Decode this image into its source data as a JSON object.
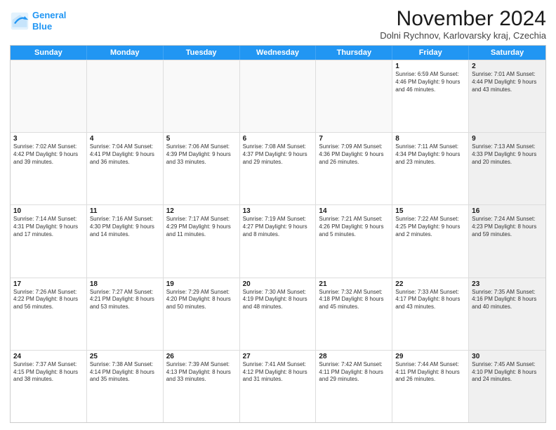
{
  "logo": {
    "line1": "General",
    "line2": "Blue"
  },
  "title": "November 2024",
  "location": "Dolni Rychnov, Karlovarsky kraj, Czechia",
  "header_days": [
    "Sunday",
    "Monday",
    "Tuesday",
    "Wednesday",
    "Thursday",
    "Friday",
    "Saturday"
  ],
  "rows": [
    [
      {
        "day": "",
        "info": "",
        "shaded": false,
        "empty": true
      },
      {
        "day": "",
        "info": "",
        "shaded": false,
        "empty": true
      },
      {
        "day": "",
        "info": "",
        "shaded": false,
        "empty": true
      },
      {
        "day": "",
        "info": "",
        "shaded": false,
        "empty": true
      },
      {
        "day": "",
        "info": "",
        "shaded": false,
        "empty": true
      },
      {
        "day": "1",
        "info": "Sunrise: 6:59 AM\nSunset: 4:46 PM\nDaylight: 9 hours\nand 46 minutes.",
        "shaded": false
      },
      {
        "day": "2",
        "info": "Sunrise: 7:01 AM\nSunset: 4:44 PM\nDaylight: 9 hours\nand 43 minutes.",
        "shaded": true
      }
    ],
    [
      {
        "day": "3",
        "info": "Sunrise: 7:02 AM\nSunset: 4:42 PM\nDaylight: 9 hours\nand 39 minutes.",
        "shaded": false
      },
      {
        "day": "4",
        "info": "Sunrise: 7:04 AM\nSunset: 4:41 PM\nDaylight: 9 hours\nand 36 minutes.",
        "shaded": false
      },
      {
        "day": "5",
        "info": "Sunrise: 7:06 AM\nSunset: 4:39 PM\nDaylight: 9 hours\nand 33 minutes.",
        "shaded": false
      },
      {
        "day": "6",
        "info": "Sunrise: 7:08 AM\nSunset: 4:37 PM\nDaylight: 9 hours\nand 29 minutes.",
        "shaded": false
      },
      {
        "day": "7",
        "info": "Sunrise: 7:09 AM\nSunset: 4:36 PM\nDaylight: 9 hours\nand 26 minutes.",
        "shaded": false
      },
      {
        "day": "8",
        "info": "Sunrise: 7:11 AM\nSunset: 4:34 PM\nDaylight: 9 hours\nand 23 minutes.",
        "shaded": false
      },
      {
        "day": "9",
        "info": "Sunrise: 7:13 AM\nSunset: 4:33 PM\nDaylight: 9 hours\nand 20 minutes.",
        "shaded": true
      }
    ],
    [
      {
        "day": "10",
        "info": "Sunrise: 7:14 AM\nSunset: 4:31 PM\nDaylight: 9 hours\nand 17 minutes.",
        "shaded": false
      },
      {
        "day": "11",
        "info": "Sunrise: 7:16 AM\nSunset: 4:30 PM\nDaylight: 9 hours\nand 14 minutes.",
        "shaded": false
      },
      {
        "day": "12",
        "info": "Sunrise: 7:17 AM\nSunset: 4:29 PM\nDaylight: 9 hours\nand 11 minutes.",
        "shaded": false
      },
      {
        "day": "13",
        "info": "Sunrise: 7:19 AM\nSunset: 4:27 PM\nDaylight: 9 hours\nand 8 minutes.",
        "shaded": false
      },
      {
        "day": "14",
        "info": "Sunrise: 7:21 AM\nSunset: 4:26 PM\nDaylight: 9 hours\nand 5 minutes.",
        "shaded": false
      },
      {
        "day": "15",
        "info": "Sunrise: 7:22 AM\nSunset: 4:25 PM\nDaylight: 9 hours\nand 2 minutes.",
        "shaded": false
      },
      {
        "day": "16",
        "info": "Sunrise: 7:24 AM\nSunset: 4:23 PM\nDaylight: 8 hours\nand 59 minutes.",
        "shaded": true
      }
    ],
    [
      {
        "day": "17",
        "info": "Sunrise: 7:26 AM\nSunset: 4:22 PM\nDaylight: 8 hours\nand 56 minutes.",
        "shaded": false
      },
      {
        "day": "18",
        "info": "Sunrise: 7:27 AM\nSunset: 4:21 PM\nDaylight: 8 hours\nand 53 minutes.",
        "shaded": false
      },
      {
        "day": "19",
        "info": "Sunrise: 7:29 AM\nSunset: 4:20 PM\nDaylight: 8 hours\nand 50 minutes.",
        "shaded": false
      },
      {
        "day": "20",
        "info": "Sunrise: 7:30 AM\nSunset: 4:19 PM\nDaylight: 8 hours\nand 48 minutes.",
        "shaded": false
      },
      {
        "day": "21",
        "info": "Sunrise: 7:32 AM\nSunset: 4:18 PM\nDaylight: 8 hours\nand 45 minutes.",
        "shaded": false
      },
      {
        "day": "22",
        "info": "Sunrise: 7:33 AM\nSunset: 4:17 PM\nDaylight: 8 hours\nand 43 minutes.",
        "shaded": false
      },
      {
        "day": "23",
        "info": "Sunrise: 7:35 AM\nSunset: 4:16 PM\nDaylight: 8 hours\nand 40 minutes.",
        "shaded": true
      }
    ],
    [
      {
        "day": "24",
        "info": "Sunrise: 7:37 AM\nSunset: 4:15 PM\nDaylight: 8 hours\nand 38 minutes.",
        "shaded": false
      },
      {
        "day": "25",
        "info": "Sunrise: 7:38 AM\nSunset: 4:14 PM\nDaylight: 8 hours\nand 35 minutes.",
        "shaded": false
      },
      {
        "day": "26",
        "info": "Sunrise: 7:39 AM\nSunset: 4:13 PM\nDaylight: 8 hours\nand 33 minutes.",
        "shaded": false
      },
      {
        "day": "27",
        "info": "Sunrise: 7:41 AM\nSunset: 4:12 PM\nDaylight: 8 hours\nand 31 minutes.",
        "shaded": false
      },
      {
        "day": "28",
        "info": "Sunrise: 7:42 AM\nSunset: 4:11 PM\nDaylight: 8 hours\nand 29 minutes.",
        "shaded": false
      },
      {
        "day": "29",
        "info": "Sunrise: 7:44 AM\nSunset: 4:11 PM\nDaylight: 8 hours\nand 26 minutes.",
        "shaded": false
      },
      {
        "day": "30",
        "info": "Sunrise: 7:45 AM\nSunset: 4:10 PM\nDaylight: 8 hours\nand 24 minutes.",
        "shaded": true
      }
    ]
  ]
}
